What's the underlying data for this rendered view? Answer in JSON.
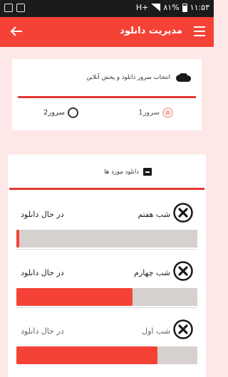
{
  "status_bar": {
    "time": "۱۱:۵۳",
    "battery": "۸۱%",
    "network": "H+"
  },
  "app_bar": {
    "title": "مدیریت دانلود",
    "back_icon": "arrow-left-icon",
    "menu_icon": "hamburger-menu-icon"
  },
  "server_card": {
    "heading": "انتخاب سرور دانلود و پخش آنلاین",
    "heading_icon": "cloud-icon",
    "options": [
      {
        "label": "سرور1",
        "selected": true
      },
      {
        "label": "سرور2",
        "selected": false
      }
    ]
  },
  "downloads": {
    "heading": "دانلود مورد ها",
    "heading_icon": "archive-icon",
    "items": [
      {
        "name": "شب هفتم",
        "status": "در حال دانلود",
        "progress": 0.01
      },
      {
        "name": "شب چهارم",
        "status": "در حال دانلود",
        "progress": 0.64
      },
      {
        "name": "شب اول",
        "status": "در حال دانلود",
        "progress": 0.78
      }
    ]
  },
  "colors": {
    "accent": "#f44336",
    "background": "#fde8e7",
    "track": "#d6d0cf"
  }
}
